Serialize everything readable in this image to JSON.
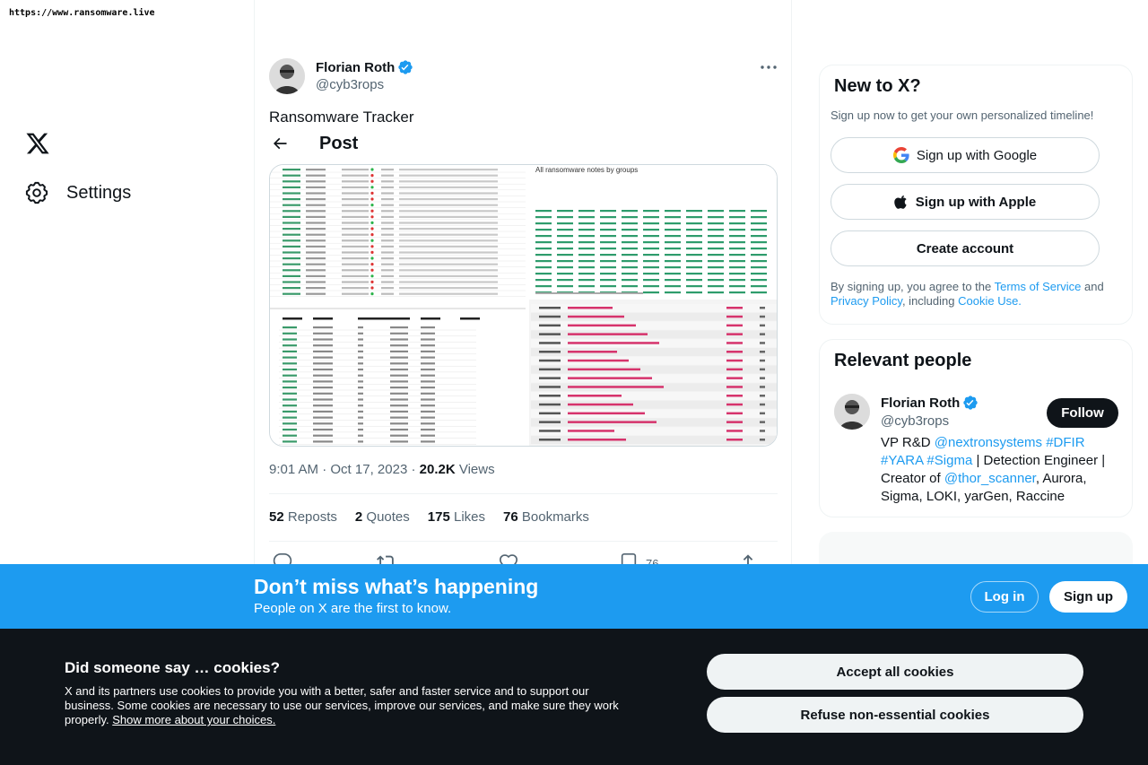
{
  "watermark": "https://www.ransomware.live",
  "nav": {
    "settings_label": "Settings"
  },
  "post": {
    "header_title": "Post",
    "author_name": "Florian Roth",
    "author_handle": "@cyb3rops",
    "text": "Ransomware Tracker",
    "time": "9:01 AM",
    "date": "Oct 17, 2023",
    "views_count": "20.2K",
    "views_label": "Views",
    "stats": {
      "reposts_count": "52",
      "reposts_label": "Reposts",
      "quotes_count": "2",
      "quotes_label": "Quotes",
      "likes_count": "175",
      "likes_label": "Likes",
      "bookmarks_count": "76",
      "bookmarks_label": "Bookmarks"
    },
    "bookmark_action_count": "76",
    "media": {
      "right_header": "All ransomware notes by groups",
      "left_columns": [
        "Ransomware",
        "Name",
        "# Msg",
        "Chat",
        "Initial Ransom",
        "Negotiated Ransom",
        "Paid"
      ],
      "recent_rows": [
        [
          "2023-10-16",
          "cepsica.org",
          "lockbit3"
        ],
        [
          "2023-10-16",
          "OCC SpA",
          "cactus"
        ],
        [
          "2023-10-16",
          "Nexstream Technologies",
          "ransomed"
        ],
        [
          "2023-10-16",
          "omtproducts.co.uk",
          "blackbasta"
        ],
        [
          "2023-10-16",
          "Symposio Organizzazione Congressi S.R.L",
          "medusa"
        ],
        [
          "2023-10-16",
          "Global Product Sales",
          "medusa"
        ],
        [
          "2023-10-16",
          "EHB",
          "medusa"
        ],
        [
          "2023-10-16",
          "GTS Tradution",
          "medusa"
        ],
        [
          "2023-10-16",
          "Ransomedvc Pentest Services!",
          "ransomed"
        ],
        [
          "2023-10-16",
          "Welcome Productions",
          "medusa"
        ],
        [
          "2023-10-16",
          "Natsa Mexican Mission Ministries",
          "alphv"
        ],
        [
          "2023-10-16",
          "DORWIN-BALCARET_2",
          "blackbasta"
        ],
        [
          "2023-10-16",
          "WLD_2",
          "blackbasta"
        ],
        [
          "2023-10-16",
          "DE - Clarification",
          "ransomed"
        ],
        [
          "2023-10-16",
          "Rob Lee Evidence - Sneak Peek",
          "ransomed"
        ],
        [
          "2023-10-16",
          "Good Industry",
          "ragnar"
        ]
      ]
    }
  },
  "signup_card": {
    "title": "New to X?",
    "subtitle": "Sign up now to get your own personalized timeline!",
    "google_label": "Sign up with Google",
    "apple_label": "Sign up with Apple",
    "create_label": "Create account",
    "legal_prefix": "By signing up, you agree to the ",
    "terms_link": "Terms of Service",
    "legal_and": " and ",
    "privacy_link": "Privacy Policy",
    "legal_including": ", including ",
    "cookie_link": "Cookie Use.",
    "colors": {
      "link": "#1d9bf0"
    }
  },
  "people_card": {
    "title": "Relevant people",
    "name": "Florian Roth",
    "handle": "@cyb3rops",
    "follow_label": "Follow",
    "bio": {
      "part1": "VP R&D ",
      "link1": "@nextronsystems",
      "sp1": " ",
      "link2": "#DFIR",
      "sp2": " ",
      "link3": "#YARA",
      "sp3": " ",
      "link4": "#Sigma",
      "part2": " | Detection Engineer | Creator of ",
      "link5": "@thor_scanner",
      "part3": ", Aurora, Sigma, LOKI, yarGen, Raccine"
    }
  },
  "banner": {
    "title": "Don’t miss what’s happening",
    "subtitle": "People on X are the first to know.",
    "login_label": "Log in",
    "signup_label": "Sign up",
    "color": "#1d9bf0"
  },
  "cookie_bar": {
    "title": "Did someone say … cookies?",
    "text": "X and its partners use cookies to provide you with a better, safer and faster service and to support our business. Some cookies are necessary to use our services, improve our services, and make sure they work properly. ",
    "link": "Show more about your choices.",
    "accept_label": "Accept all cookies",
    "refuse_label": "Refuse non-essential cookies"
  }
}
